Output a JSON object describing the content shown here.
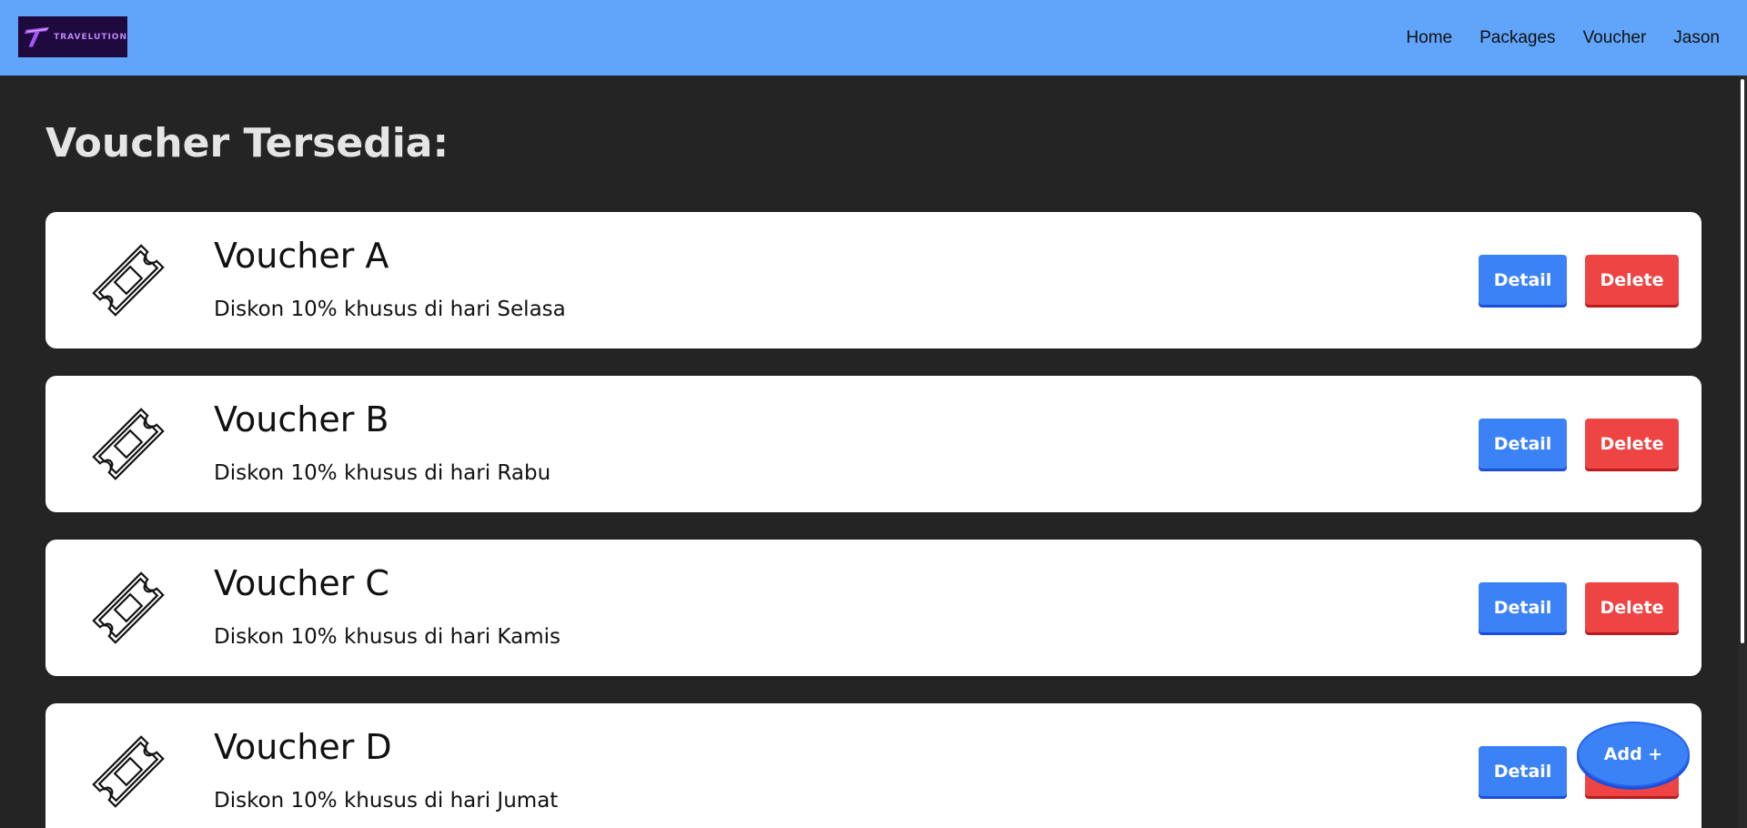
{
  "brand": {
    "name": "TRAVELUTION",
    "icon": "travelution-logo"
  },
  "nav": {
    "links": [
      "Home",
      "Packages",
      "Voucher",
      "Jason"
    ]
  },
  "page_title": "Voucher Tersedia:",
  "vouchers": [
    {
      "title": "Voucher A",
      "description": "Diskon 10% khusus di hari Selasa",
      "icon": "ticket-icon"
    },
    {
      "title": "Voucher B",
      "description": "Diskon 10% khusus di hari Rabu",
      "icon": "ticket-icon"
    },
    {
      "title": "Voucher C",
      "description": "Diskon 10% khusus di hari Kamis",
      "icon": "ticket-icon"
    },
    {
      "title": "Voucher D",
      "description": "Diskon 10% khusus di hari Jumat",
      "icon": "ticket-icon"
    }
  ],
  "buttons": {
    "detail": "Detail",
    "delete": "Delete",
    "add": "Add +"
  },
  "colors": {
    "navbar": "#60a5fa",
    "background": "#242424",
    "detail": "#3b82f6",
    "delete": "#ef4444"
  }
}
